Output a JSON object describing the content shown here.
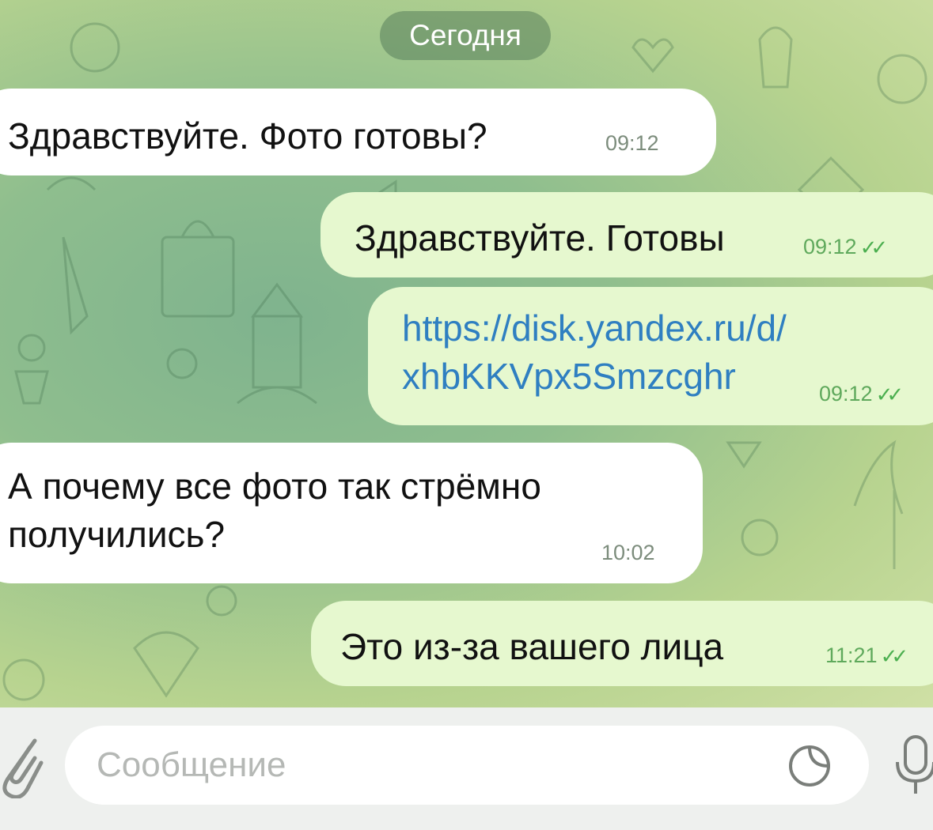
{
  "date_divider": "Сегодня",
  "messages": [
    {
      "direction": "incoming",
      "text": "Здравствуйте. Фото готовы?",
      "time": "09:12"
    },
    {
      "direction": "outgoing",
      "text": "Здравствуйте. Готовы",
      "time": "09:12",
      "status": "read"
    },
    {
      "direction": "outgoing",
      "text_line1": "https://disk.yandex.ru/d/",
      "text_line2": "xhbKKVpx5Smzcghr",
      "time": "09:12",
      "status": "read",
      "is_link": true
    },
    {
      "direction": "incoming",
      "text_line1": "А почему все фото так стрёмно",
      "text_line2": "получились?",
      "time": "10:02"
    },
    {
      "direction": "outgoing",
      "text": "Это из-за вашего лица",
      "time": "11:21",
      "status": "read"
    }
  ],
  "composer": {
    "placeholder": "Сообщение",
    "icons": [
      "attach-icon",
      "sticker-icon",
      "microphone-icon"
    ]
  },
  "colors": {
    "incoming_bubble": "#ffffff",
    "outgoing_bubble": "#e6f8cf",
    "link": "#2f7fc1",
    "check": "#4caf50"
  }
}
